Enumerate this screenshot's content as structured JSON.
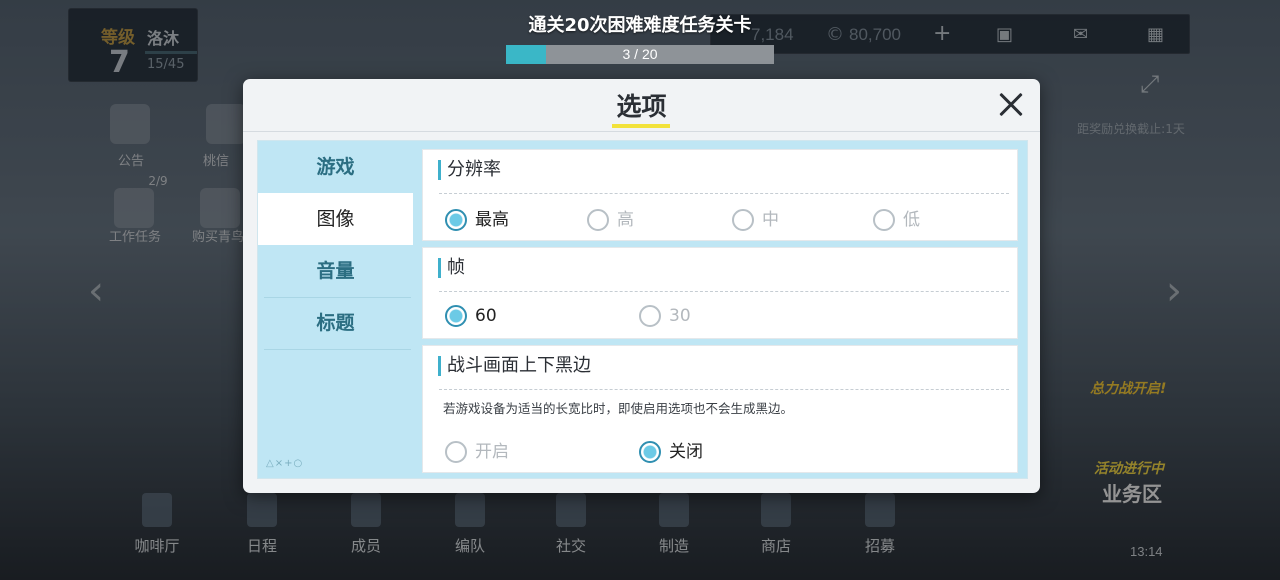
{
  "mission": {
    "title": "通关20次困难难度任务关卡",
    "progress_text": "3 / 20",
    "progress_fraction": 0.15
  },
  "player": {
    "level_label": "等级",
    "level": "7",
    "name": "洛沐",
    "exp": "15/45"
  },
  "currency": {
    "value1": "7,184",
    "value2": "80,700",
    "plus": "+"
  },
  "side_buttons": {
    "notice": "公告",
    "peach": "桃信",
    "work_task": "工作任务",
    "work_count": "2/9",
    "buy": "购买青鸟"
  },
  "right_side": {
    "countdown": "距奖励兑换截止:1天",
    "event1": "总力战开启!",
    "event2": "活动进行中",
    "area": "业务区"
  },
  "bottom_nav": [
    "咖啡厅",
    "日程",
    "成员",
    "编队",
    "社交",
    "制造",
    "商店",
    "招募"
  ],
  "clock": "13:14",
  "dialog": {
    "title": "选项",
    "menu": [
      "游戏",
      "图像",
      "音量",
      "标题"
    ],
    "menu_deco": "△×+○",
    "active_menu": 1,
    "resolution": {
      "title": "分辨率",
      "options": [
        "最高",
        "高",
        "中",
        "低"
      ],
      "selected": 0
    },
    "frame": {
      "title": "帧",
      "options": [
        "60",
        "30"
      ],
      "selected": 0
    },
    "letterbox": {
      "title": "战斗画面上下黑边",
      "note": "若游戏设备为适当的长宽比时，即使启用选项也不会生成黑边。",
      "options": [
        "开启",
        "关闭"
      ],
      "selected": 1
    }
  },
  "colors": {
    "accent": "#3fb0cc",
    "menu_bg": "#bfe6f4",
    "highlight": "#f2e23a",
    "progress": "#3ab7c7"
  }
}
